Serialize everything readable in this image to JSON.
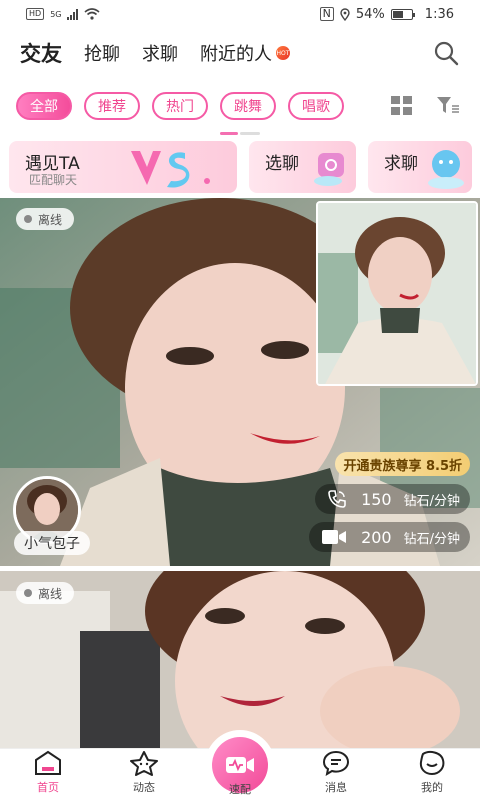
{
  "status_bar": {
    "hd": "HD",
    "network": "5G",
    "nfc": "N",
    "battery": "54%",
    "battery_level": 0.54,
    "time": "1:36"
  },
  "top_nav": {
    "tabs": [
      {
        "label": "交友",
        "active": true
      },
      {
        "label": "抢聊",
        "active": false
      },
      {
        "label": "求聊",
        "active": false
      },
      {
        "label": "附近的人",
        "active": false,
        "badge": "hot-icon"
      }
    ],
    "search_icon": "search-icon"
  },
  "filters": {
    "chips": [
      {
        "label": "全部",
        "active": true
      },
      {
        "label": "推荐",
        "active": false
      },
      {
        "label": "热门",
        "active": false
      },
      {
        "label": "跳舞",
        "active": false
      },
      {
        "label": "唱歌",
        "active": false
      }
    ],
    "grid_icon": "grid-view-icon",
    "filter_icon": "filter-icon"
  },
  "banners": [
    {
      "title": "遇见TA",
      "subtitle": "匹配聊天",
      "art": "VS"
    },
    {
      "title": "选聊",
      "art": "chat-bubble-icon"
    },
    {
      "title": "求聊",
      "art": "cloud-chat-icon"
    }
  ],
  "cards": [
    {
      "status": "离线",
      "vip_promo": "开通贵族尊享 8.5折",
      "voice": {
        "price": "150",
        "unit": "钻石/分钟",
        "icon": "phone-icon"
      },
      "video": {
        "price": "200",
        "unit": "钻石/分钟",
        "icon": "video-camera-icon"
      },
      "nickname": "小气包子"
    },
    {
      "status": "离线"
    }
  ],
  "bottom_nav": {
    "items": [
      {
        "label": "首页",
        "icon": "home-icon",
        "active": true
      },
      {
        "label": "动态",
        "icon": "star-icon",
        "active": false
      },
      {
        "label": "速配",
        "icon": "speed-match-icon",
        "active": false
      },
      {
        "label": "消息",
        "icon": "message-icon",
        "active": false
      },
      {
        "label": "我的",
        "icon": "profile-icon",
        "active": false
      }
    ]
  },
  "colors": {
    "accent": "#f0468f",
    "chip_gradient_start": "#ff7ec0",
    "vip_gold": "#f3cd73"
  }
}
